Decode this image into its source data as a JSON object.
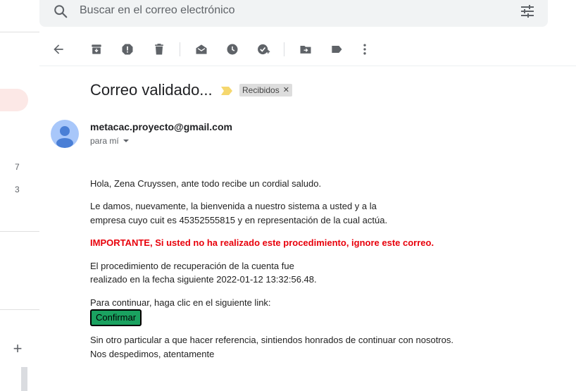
{
  "search": {
    "placeholder": "Buscar en el correo electrónico"
  },
  "sidebar": {
    "counts": [
      "7",
      "3"
    ]
  },
  "toolbar": {
    "buttons": [
      "back",
      "archive",
      "report-spam",
      "delete",
      "mark-unread",
      "snooze",
      "add-to-tasks",
      "move-to",
      "labels",
      "more"
    ]
  },
  "email": {
    "subject": "Correo validado...",
    "label": "Recibidos",
    "sender": "metacac.proyecto@gmail.com",
    "recipient": "para mí",
    "body": {
      "greeting": "Hola, Zena Cruyssen, ante todo recibe un cordial saludo.",
      "welcome_line1": "Le damos, nuevamente, la bienvenida a nuestro sistema a usted y a la",
      "welcome_line2": "empresa cuyo cuit es 45352555815 y en representación de la cual actúa.",
      "important": "IMPORTANTE, Si usted no ha realizado este procedimiento, ignore este correo.",
      "procedure_line1": "El procedimiento de recuperación de la cuenta fue",
      "procedure_line2": "realizado en la fecha siguiente 2022-01-12 13:32:56.48.",
      "continue": "Para continuar, haga clic en el siguiente link:",
      "button": "Confirmar",
      "closing_line1": "Sin otro particular a que hacer referencia, sintiendos honrados de continuar con nosotros.",
      "closing_line2": "Nos despedimos, atentamente"
    }
  },
  "colors": {
    "important_text": "#e8000b",
    "confirm_button": "#1aa260",
    "importance_marker": "#f5d76e"
  }
}
